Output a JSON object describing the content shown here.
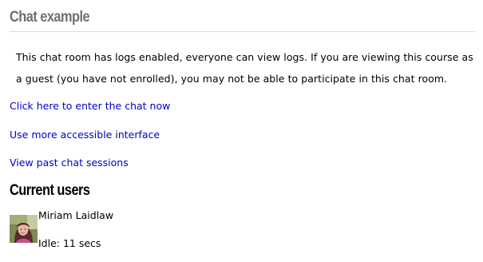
{
  "page": {
    "title": "Chat example",
    "intro": "This chat room has logs enabled, everyone can view logs. If you are viewing this course as a guest (you have not enrolled), you may not be able to participate in this chat room."
  },
  "links": {
    "enter_chat": "Click here to enter the chat now",
    "accessible_interface": "Use more accessible interface",
    "past_sessions": "View past chat sessions"
  },
  "current_users": {
    "heading": "Current users",
    "users": [
      {
        "name": "Miriam Laidlaw",
        "idle": "Idle: 11 secs",
        "avatar": "user-photo"
      }
    ]
  },
  "colors": {
    "title": "#707070",
    "link": "#0000cc",
    "rule": "#dddddd"
  }
}
